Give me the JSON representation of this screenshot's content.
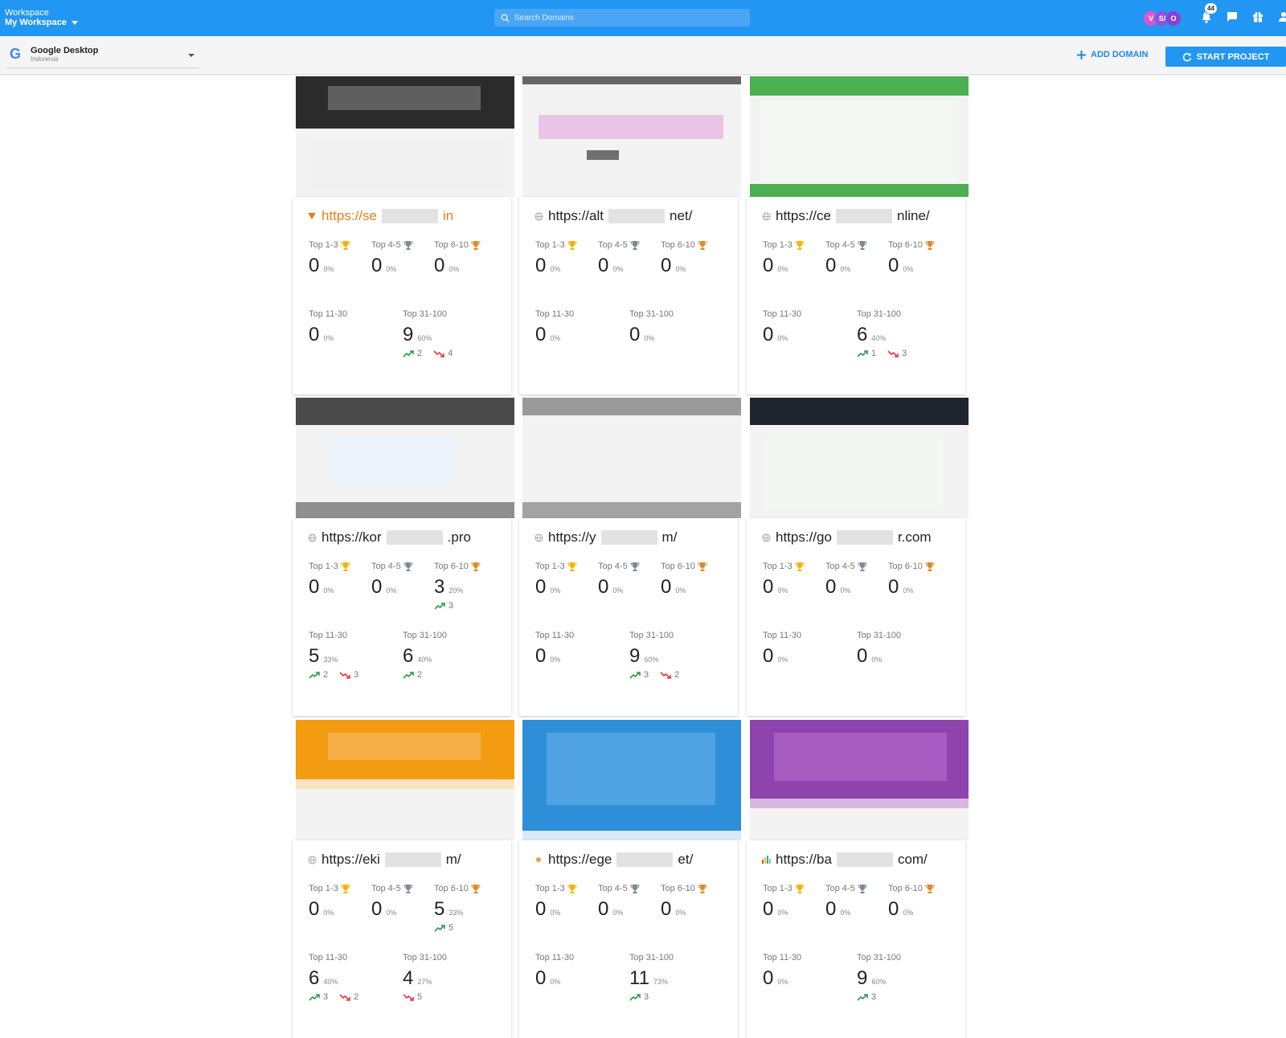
{
  "workspace": {
    "label": "Workspace",
    "name": "My Workspace"
  },
  "search": {
    "placeholder": "Search Domains"
  },
  "avatars": [
    {
      "letter": "V",
      "color": "#e056c9"
    },
    {
      "letter": "S/",
      "color": "#9c4dd9"
    },
    {
      "letter": "O",
      "color": "#8a3fd1"
    }
  ],
  "notifications": {
    "count": "44"
  },
  "engine": {
    "name": "Google Desktop",
    "location": "Indonesia",
    "logo_letter": "G"
  },
  "actions": {
    "add_domain": "ADD DOMAIN",
    "start_project": "START PROJECT"
  },
  "labels": {
    "top13": "Top 1-3",
    "top45": "Top 4-5",
    "top610": "Top 6-10",
    "top1130": "Top 11-30",
    "top31100": "Top 31-100"
  },
  "cards": [
    {
      "url": "https://se",
      "url_tail": "in",
      "url_color": "#f07c1a",
      "thumb": "dark",
      "t13": {
        "n": "0",
        "p": "0%"
      },
      "t45": {
        "n": "0",
        "p": "0%"
      },
      "t610": {
        "n": "0",
        "p": "0%"
      },
      "t1130": {
        "n": "0",
        "p": "0%"
      },
      "t31100": {
        "n": "9",
        "p": "60%",
        "up": "2",
        "down": "4"
      }
    },
    {
      "url": "https://alt",
      "url_tail": "net/",
      "url_color": "#222",
      "thumb": "pink",
      "t13": {
        "n": "0",
        "p": "0%"
      },
      "t45": {
        "n": "0",
        "p": "0%"
      },
      "t610": {
        "n": "0",
        "p": "0%"
      },
      "t1130": {
        "n": "0",
        "p": "0%"
      },
      "t31100": {
        "n": "0",
        "p": "0%"
      }
    },
    {
      "url": "https://ce",
      "url_tail": "nline/",
      "url_color": "#222",
      "thumb": "green",
      "t13": {
        "n": "0",
        "p": "0%"
      },
      "t45": {
        "n": "0",
        "p": "0%"
      },
      "t610": {
        "n": "0",
        "p": "0%"
      },
      "t1130": {
        "n": "0",
        "p": "0%"
      },
      "t31100": {
        "n": "6",
        "p": "40%",
        "up": "1",
        "down": "3"
      }
    },
    {
      "url": "https://kor",
      "url_tail": ".pro",
      "url_color": "#222",
      "thumb": "grey",
      "t13": {
        "n": "0",
        "p": "0%"
      },
      "t45": {
        "n": "0",
        "p": "0%"
      },
      "t610": {
        "n": "3",
        "p": "20%",
        "up": "3"
      },
      "t1130": {
        "n": "5",
        "p": "33%",
        "up": "2",
        "down": "3"
      },
      "t31100": {
        "n": "6",
        "p": "40%",
        "up": "2"
      }
    },
    {
      "url": "https://y",
      "url_tail": "m/",
      "url_color": "#222",
      "thumb": "grey2",
      "t13": {
        "n": "0",
        "p": "0%"
      },
      "t45": {
        "n": "0",
        "p": "0%"
      },
      "t610": {
        "n": "0",
        "p": "0%"
      },
      "t1130": {
        "n": "0",
        "p": "0%"
      },
      "t31100": {
        "n": "9",
        "p": "60%",
        "up": "3",
        "down": "2"
      }
    },
    {
      "url": "https://go",
      "url_tail": "r.com",
      "url_color": "#222",
      "thumb": "navy",
      "t13": {
        "n": "0",
        "p": "0%"
      },
      "t45": {
        "n": "0",
        "p": "0%"
      },
      "t610": {
        "n": "0",
        "p": "0%"
      },
      "t1130": {
        "n": "0",
        "p": "0%"
      },
      "t31100": {
        "n": "0",
        "p": "0%"
      }
    },
    {
      "url": "https://eki",
      "url_tail": "m/",
      "url_color": "#222",
      "thumb": "orange",
      "t13": {
        "n": "0",
        "p": "0%"
      },
      "t45": {
        "n": "0",
        "p": "0%"
      },
      "t610": {
        "n": "5",
        "p": "33%",
        "up": "5"
      },
      "t1130": {
        "n": "6",
        "p": "40%",
        "up": "3",
        "down": "2"
      },
      "t31100": {
        "n": "4",
        "p": "27%",
        "down": "5"
      }
    },
    {
      "url": "https://ege",
      "url_tail": "et/",
      "url_color": "#222",
      "thumb": "blue",
      "t13": {
        "n": "0",
        "p": "0%"
      },
      "t45": {
        "n": "0",
        "p": "0%"
      },
      "t610": {
        "n": "0",
        "p": "0%"
      },
      "t1130": {
        "n": "0",
        "p": "0%"
      },
      "t31100": {
        "n": "11",
        "p": "73%",
        "up": "3"
      }
    },
    {
      "url": "https://ba",
      "url_tail": "com/",
      "url_color": "#222",
      "thumb": "purple",
      "t13": {
        "n": "0",
        "p": "0%"
      },
      "t45": {
        "n": "0",
        "p": "0%"
      },
      "t610": {
        "n": "0",
        "p": "0%"
      },
      "t1130": {
        "n": "0",
        "p": "0%"
      },
      "t31100": {
        "n": "9",
        "p": "60%",
        "up": "3"
      }
    }
  ],
  "colors": {
    "primary": "#2196f3",
    "gold": "#f4b400",
    "silver": "#7c8a97",
    "bronze": "#e08a2a",
    "trend_up": "#2e9a47",
    "trend_down": "#e03a3a"
  }
}
